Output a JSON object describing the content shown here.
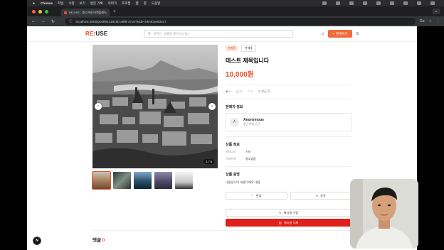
{
  "menubar": {
    "app": "Chrome",
    "items": [
      "파일",
      "수정",
      "보기",
      "방문 기록",
      "북마크",
      "프로필",
      "탭",
      "창",
      "도움말"
    ]
  },
  "browser": {
    "tab_title": "RE:USE - 중고거래 마켓플레이스",
    "url": "localhost:3000/post/9141815b-a9f6-47c0-94de-49e301e93e17",
    "profile_badge": "Go"
  },
  "header": {
    "logo_main": "RE",
    "logo_colon": ":",
    "logo_end": "USE",
    "search_placeholder": "원하는 상품을 찾으시나요?",
    "sell_label": "판매하기",
    "user_initial": "S"
  },
  "gallery": {
    "counter": "1 / 5",
    "prev": "‹",
    "next": "›"
  },
  "product": {
    "status_badge": "판매중",
    "status_select": "판매중",
    "title": "테스트 제목입니다",
    "price": "10,000원",
    "views": "0",
    "chats": "0",
    "likes": "0",
    "time": "방금 전"
  },
  "seller": {
    "section_title": "판매자 정보",
    "avatar_initial": "A",
    "name": "Anonymous",
    "subtitle": "평균 판매 기간"
  },
  "details": {
    "section_title": "상품 정보",
    "rows": [
      {
        "key": "카테고리",
        "value": "기타"
      },
      {
        "key": "거래지역",
        "value": "장소없음"
      }
    ]
  },
  "description": {
    "section_title": "상품 설명",
    "text": "내용입니다 내용이에요 내용"
  },
  "actions": {
    "like": "관심",
    "share": "공유",
    "edit": "게시글 수정",
    "delete": "게시글 삭제"
  },
  "comments": {
    "label": "댓글",
    "count": "0"
  },
  "dev_indicator": "N"
}
